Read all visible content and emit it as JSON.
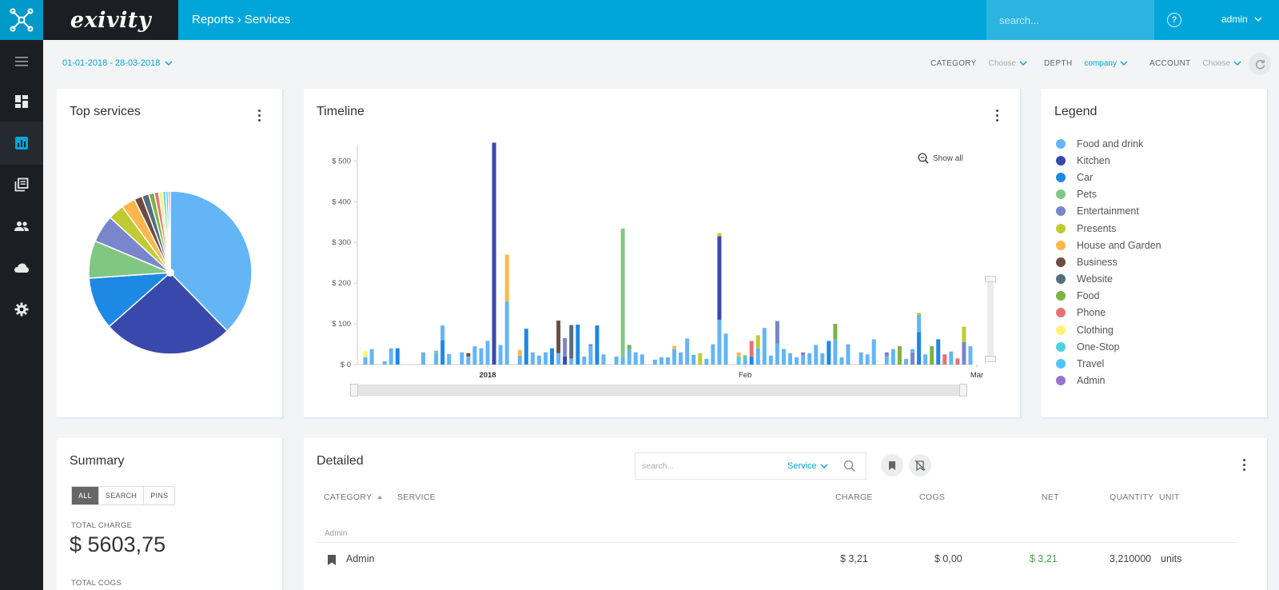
{
  "app": {
    "brand": "exivity",
    "breadcrumb": "Reports › Services"
  },
  "header": {
    "search_placeholder": "search...",
    "user": "admin"
  },
  "sidebar": {
    "items": [
      "menu-icon",
      "dashboard-icon",
      "reports-icon",
      "catalogue-icon",
      "users-icon",
      "cloud-icon",
      "gear-icon"
    ]
  },
  "filters": {
    "date_range": "01-01-2018 - 28-03-2018",
    "category_label": "CATEGORY",
    "category_value": "Choose",
    "depth_label": "DEPTH",
    "depth_value": "company",
    "account_label": "ACCOUNT",
    "account_value": "Choose"
  },
  "top_services": {
    "title": "Top services"
  },
  "timeline": {
    "title": "Timeline",
    "show_all": "Show all"
  },
  "legend": {
    "title": "Legend",
    "items": [
      {
        "label": "Food and drink",
        "color": "#64b5f6"
      },
      {
        "label": "Kitchen",
        "color": "#3949ab"
      },
      {
        "label": "Car",
        "color": "#1e88e5"
      },
      {
        "label": "Pets",
        "color": "#81c784"
      },
      {
        "label": "Entertainment",
        "color": "#7986cb"
      },
      {
        "label": "Presents",
        "color": "#c0ca33"
      },
      {
        "label": "House and Garden",
        "color": "#ffb74d"
      },
      {
        "label": "Business",
        "color": "#6d4c41"
      },
      {
        "label": "Website",
        "color": "#546e7a"
      },
      {
        "label": "Food",
        "color": "#7cb342"
      },
      {
        "label": "Phone",
        "color": "#e57373"
      },
      {
        "label": "Clothing",
        "color": "#fff176"
      },
      {
        "label": "One-Stop",
        "color": "#4dd0e1"
      },
      {
        "label": "Travel",
        "color": "#4fc3f7"
      },
      {
        "label": "Admin",
        "color": "#9575cd"
      }
    ]
  },
  "chart_data": [
    {
      "type": "pie",
      "title": "Top services",
      "categories": [
        "Food and drink",
        "Kitchen",
        "Car",
        "Pets",
        "Entertainment",
        "Presents",
        "House and Garden",
        "Business",
        "Website",
        "Food",
        "Phone",
        "Clothing",
        "One-Stop",
        "Travel",
        "Admin"
      ],
      "values": [
        38,
        26,
        10.5,
        7.5,
        5.5,
        3.2,
        2.8,
        1.6,
        1.4,
        1.1,
        0.9,
        0.8,
        0.6,
        0.5,
        0.4
      ],
      "colors": [
        "#64b5f6",
        "#3949ab",
        "#1e88e5",
        "#81c784",
        "#7986cb",
        "#c0ca33",
        "#ffb74d",
        "#6d4c41",
        "#546e7a",
        "#7cb342",
        "#e57373",
        "#fff176",
        "#4dd0e1",
        "#4fc3f7",
        "#9575cd"
      ]
    },
    {
      "type": "bar",
      "title": "Timeline",
      "ylim": [
        0,
        540
      ],
      "yticks": [
        "$ 0",
        "$ 100",
        "$ 200",
        "$ 300",
        "$ 400",
        "$ 500"
      ],
      "xticks": [
        {
          "label": "2018",
          "bold": true,
          "index": 19
        },
        {
          "label": "Feb",
          "bold": false,
          "index": 59
        },
        {
          "label": "Mar",
          "bold": false,
          "index": 95
        }
      ],
      "bars": [
        [
          [
            0,
            18
          ],
          [
            11,
            15
          ]
        ],
        [
          [
            0,
            38
          ]
        ],
        [],
        [
          [
            0,
            8
          ]
        ],
        [
          [
            0,
            40
          ]
        ],
        [
          [
            2,
            40
          ]
        ],
        [],
        [],
        [],
        [
          [
            0,
            30
          ]
        ],
        [],
        [
          [
            0,
            28
          ],
          [
            3,
            6
          ]
        ],
        [
          [
            2,
            60
          ],
          [
            0,
            36
          ]
        ],
        [
          [
            0,
            26
          ]
        ],
        [],
        [
          [
            0,
            30
          ]
        ],
        [
          [
            0,
            20
          ],
          [
            7,
            8
          ]
        ],
        [
          [
            0,
            45
          ]
        ],
        [
          [
            0,
            40
          ]
        ],
        [
          [
            0,
            58
          ]
        ],
        [
          [
            1,
            545
          ]
        ],
        [
          [
            0,
            48
          ]
        ],
        [
          [
            0,
            155
          ],
          [
            6,
            115
          ]
        ],
        [],
        [
          [
            0,
            22
          ],
          [
            6,
            14
          ]
        ],
        [
          [
            2,
            88
          ]
        ],
        [
          [
            0,
            30
          ]
        ],
        [
          [
            0,
            22
          ]
        ],
        [
          [
            0,
            30
          ]
        ],
        [
          [
            2,
            40
          ]
        ],
        [
          [
            0,
            28
          ],
          [
            7,
            80
          ]
        ],
        [
          [
            1,
            20
          ],
          [
            4,
            45
          ]
        ],
        [
          [
            0,
            15
          ],
          [
            8,
            82
          ]
        ],
        [
          [
            2,
            98
          ]
        ],
        [
          [
            0,
            20
          ]
        ],
        [
          [
            0,
            45
          ],
          [
            4,
            5
          ]
        ],
        [
          [
            2,
            96
          ]
        ],
        [
          [
            0,
            25
          ]
        ],
        [],
        [
          [
            0,
            20
          ]
        ],
        [
          [
            0,
            18
          ],
          [
            3,
            316
          ]
        ],
        [
          [
            0,
            38
          ],
          [
            9,
            10
          ]
        ],
        [
          [
            0,
            30
          ]
        ],
        [
          [
            0,
            25
          ]
        ],
        [],
        [
          [
            0,
            12
          ]
        ],
        [
          [
            0,
            18
          ]
        ],
        [
          [
            0,
            18
          ]
        ],
        [
          [
            0,
            38
          ],
          [
            6,
            8
          ]
        ],
        [
          [
            0,
            30
          ]
        ],
        [
          [
            0,
            64
          ]
        ],
        [
          [
            0,
            24
          ]
        ],
        [
          [
            5,
            28
          ]
        ],
        [
          [
            0,
            14
          ]
        ],
        [
          [
            0,
            50
          ]
        ],
        [
          [
            0,
            110
          ],
          [
            1,
            205
          ],
          [
            5,
            8
          ]
        ],
        [
          [
            0,
            76
          ]
        ],
        [],
        [
          [
            12,
            20
          ],
          [
            6,
            10
          ]
        ],
        [
          [
            0,
            15
          ],
          [
            3,
            8
          ]
        ],
        [
          [
            2,
            20
          ],
          [
            10,
            38
          ]
        ],
        [
          [
            0,
            40
          ],
          [
            5,
            32
          ]
        ],
        [
          [
            0,
            90
          ]
        ],
        [
          [
            0,
            22
          ]
        ],
        [
          [
            0,
            52
          ],
          [
            4,
            55
          ]
        ],
        [
          [
            0,
            38
          ]
        ],
        [
          [
            0,
            28
          ]
        ],
        [
          [
            0,
            18
          ]
        ],
        [
          [
            0,
            22
          ],
          [
            4,
            8
          ]
        ],
        [
          [
            0,
            28
          ]
        ],
        [
          [
            0,
            48
          ]
        ],
        [
          [
            0,
            28
          ]
        ],
        [
          [
            2,
            58
          ]
        ],
        [
          [
            0,
            62
          ],
          [
            9,
            38
          ]
        ],
        [
          [
            0,
            18
          ]
        ],
        [
          [
            0,
            50
          ]
        ],
        [],
        [
          [
            0,
            30
          ]
        ],
        [
          [
            0,
            25
          ]
        ],
        [
          [
            0,
            62
          ]
        ],
        [],
        [
          [
            0,
            20
          ],
          [
            4,
            10
          ]
        ],
        [
          [
            0,
            38
          ]
        ],
        [
          [
            9,
            45
          ]
        ],
        [
          [
            0,
            14
          ]
        ],
        [
          [
            4,
            30
          ],
          [
            0,
            8
          ]
        ],
        [
          [
            2,
            80
          ],
          [
            0,
            42
          ],
          [
            5,
            5
          ]
        ],
        [
          [
            0,
            25
          ]
        ],
        [
          [
            9,
            45
          ]
        ],
        [
          [
            2,
            62
          ]
        ],
        [
          [
            10,
            25
          ]
        ],
        [
          [
            0,
            32
          ]
        ],
        [
          [
            10,
            15
          ]
        ],
        [
          [
            4,
            55
          ],
          [
            5,
            38
          ]
        ],
        [
          [
            0,
            45
          ]
        ]
      ],
      "colors": [
        "#64b5f6",
        "#3949ab",
        "#1e88e5",
        "#81c784",
        "#7986cb",
        "#c0ca33",
        "#ffb74d",
        "#6d4c41",
        "#546e7a",
        "#7cb342",
        "#e57373",
        "#fff176",
        "#4dd0e1",
        "#4fc3f7",
        "#9575cd"
      ]
    }
  ],
  "summary": {
    "title": "Summary",
    "tabs": [
      "ALL",
      "SEARCH",
      "PINS"
    ],
    "total_charge_label": "TOTAL CHARGE",
    "total_charge_value": "$ 5603,75",
    "total_cogs_label": "TOTAL COGS"
  },
  "detailed": {
    "title": "Detailed",
    "search_placeholder": "search...",
    "search_field": "Service",
    "columns": {
      "category": "CATEGORY",
      "service": "SERVICE",
      "charge": "CHARGE",
      "cogs": "COGS",
      "net": "NET",
      "quantity": "QUANTITY",
      "unit": "UNIT"
    },
    "groups": [
      {
        "label": "Admin",
        "rows": [
          {
            "service": "Admin",
            "charge": "$ 3,21",
            "cogs": "$ 0,00",
            "net": "$ 3,21",
            "quantity": "3,210000",
            "unit": "units"
          }
        ]
      }
    ]
  }
}
